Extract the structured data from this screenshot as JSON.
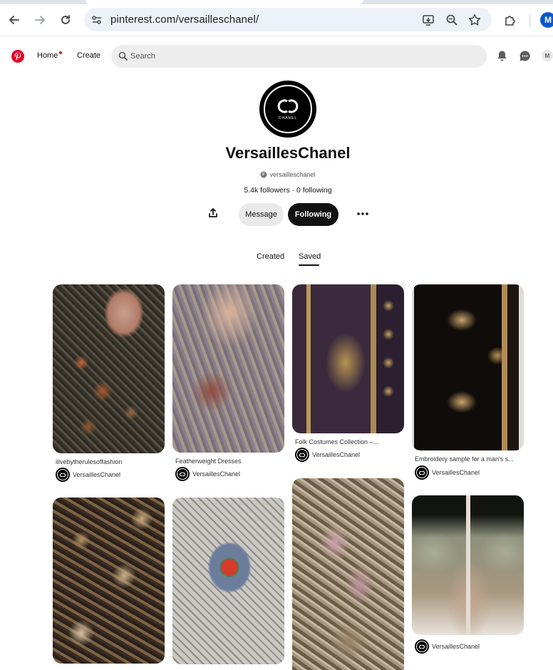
{
  "browser": {
    "url": "pinterest.com/versailleschanel/",
    "profile_initial": "M"
  },
  "header": {
    "nav_home": "Home",
    "nav_create": "Create",
    "search_placeholder": "Search",
    "avatar_initial": "M",
    "brand_color": "#e60023"
  },
  "profile": {
    "name": "VersaillesChanel",
    "handle": "versailleschanel",
    "stats": "5.4k followers · 0 following",
    "avatar_text": "CHANEL",
    "message_label": "Message",
    "following_label": "Following"
  },
  "tabs": {
    "created": "Created",
    "saved": "Saved",
    "active": "Saved"
  },
  "pins": [
    {
      "title": "ilivebytherulesoffashion",
      "owner": "VersaillesChanel"
    },
    {
      "title": "Featherweight Dresses",
      "owner": "VersaillesChanel"
    },
    {
      "title": "Folk Costumes Collection –...",
      "owner": "VersaillesChanel"
    },
    {
      "title": "Embroidery sample for a man's s...",
      "owner": "VersaillesChanel"
    },
    {
      "title": "",
      "owner": ""
    },
    {
      "title": "",
      "owner": ""
    },
    {
      "title": "",
      "owner": ""
    },
    {
      "title": "",
      "owner": "VersaillesChanel"
    }
  ]
}
